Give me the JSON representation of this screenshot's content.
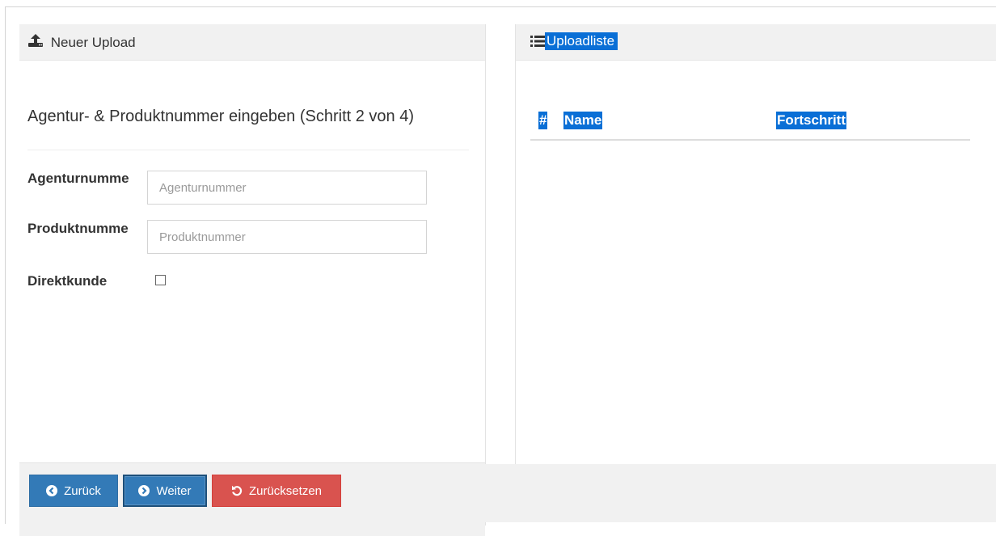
{
  "left_panel": {
    "heading": "Neuer Upload",
    "step_title": "Agentur- & Produktnummer eingeben (Schritt 2 von 4)",
    "fields": [
      {
        "label": "Agenturnumme",
        "placeholder": "Agenturnummer",
        "value": ""
      },
      {
        "label": "Produktnumme",
        "placeholder": "Produktnummer",
        "value": ""
      }
    ],
    "checkbox": {
      "label": "Direktkunde",
      "checked": false
    },
    "buttons": {
      "back": "Zurück",
      "next": "Weiter",
      "reset": "Zurücksetzen"
    }
  },
  "right_panel": {
    "heading": "Uploadliste",
    "columns": [
      "#",
      "Name",
      "Fortschritt"
    ],
    "rows": []
  },
  "colors": {
    "primary": "#337ab7",
    "danger": "#d9534f",
    "selection": "#0a6fd6",
    "panel_heading_bg": "#f1f1f1"
  },
  "icons": {
    "upload": "upload-icon",
    "list": "list-icon",
    "back": "circle-arrow-left-icon",
    "next": "circle-arrow-right-icon",
    "reset": "undo-icon"
  }
}
